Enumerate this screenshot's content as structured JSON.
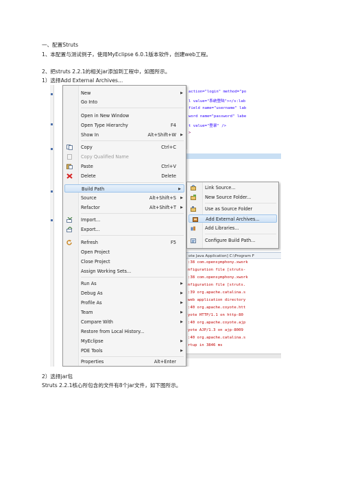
{
  "doc": {
    "heading": "一、配置Struts",
    "step1": "1、本配置与测试例子，使用MyEclipse 6.0.1版本软件，创建web工程。",
    "step2": "2、把struts 2.2.1的相关jar添加到工程中，如图所示。",
    "step2_1": "1）选择Add External Archives...",
    "step2_2": "2）选择jar包",
    "step2_3": "Struts 2.2.1核心所包含的文件有8个jar文件，如下图所示。"
  },
  "editor": {
    "lines": [
      "action=\"login\" method=\"po",
      "l value=\"系统登陆\"></s:lab",
      "field name=\"username\" lab",
      "word name=\"password\" labe",
      "t value=\"登录\" />",
      ">"
    ]
  },
  "console": {
    "header": "ote Java Application] C:\\Program F",
    "lines": [
      ":38 com.opensymphony.xwork",
      "nfiguration file [struts-",
      ":38 com.opensymphony.xwork",
      "nfiguration file [struts.",
      ":39 org.apache.catalina.s",
      "web application directory",
      ":40 org.apache.coyote.htt",
      "yote HTTP/1.1 on http-80",
      ":40 org.apache.coyote.ajp",
      "yote AJP/1.3 on ajp-8009",
      ":40 org.apache.catalina.s",
      "rtup in 3846 ms"
    ]
  },
  "menu": {
    "new": "New",
    "go_into": "Go Into",
    "open_new_window": "Open in New Window",
    "open_type_hierarchy": "Open Type Hierarchy",
    "open_type_hierarchy_sc": "F4",
    "show_in": "Show In",
    "show_in_sc": "Alt+Shift+W",
    "copy": "Copy",
    "copy_sc": "Ctrl+C",
    "copy_qualified": "Copy Qualified Name",
    "paste": "Paste",
    "paste_sc": "Ctrl+V",
    "delete": "Delete",
    "delete_sc": "Delete",
    "build_path": "Build Path",
    "source": "Source",
    "source_sc": "Alt+Shift+S",
    "refactor": "Refactor",
    "refactor_sc": "Alt+Shift+T",
    "import": "Import...",
    "export": "Export...",
    "refresh": "Refresh",
    "refresh_sc": "F5",
    "open_project": "Open Project",
    "close_project": "Close Project",
    "assign_working_sets": "Assign Working Sets...",
    "run_as": "Run As",
    "debug_as": "Debug As",
    "profile_as": "Profile As",
    "team": "Team",
    "compare_with": "Compare With",
    "restore_local_history": "Restore from Local History...",
    "myeclipse": "MyEclipse",
    "pde_tools": "PDE Tools",
    "properties": "Properties",
    "properties_sc": "Alt+Enter"
  },
  "submenu": {
    "link_source": "Link Source...",
    "new_source_folder": "New Source Folder...",
    "use_as_source_folder": "Use as Source Folder",
    "add_external_archives": "Add External Archives...",
    "add_libraries": "Add Libraries...",
    "configure_build_path": "Configure Build Path..."
  },
  "colors": {
    "highlight_border": "#9cc3ea",
    "console_error": "#c00000",
    "code_string": "#2a00ff"
  }
}
